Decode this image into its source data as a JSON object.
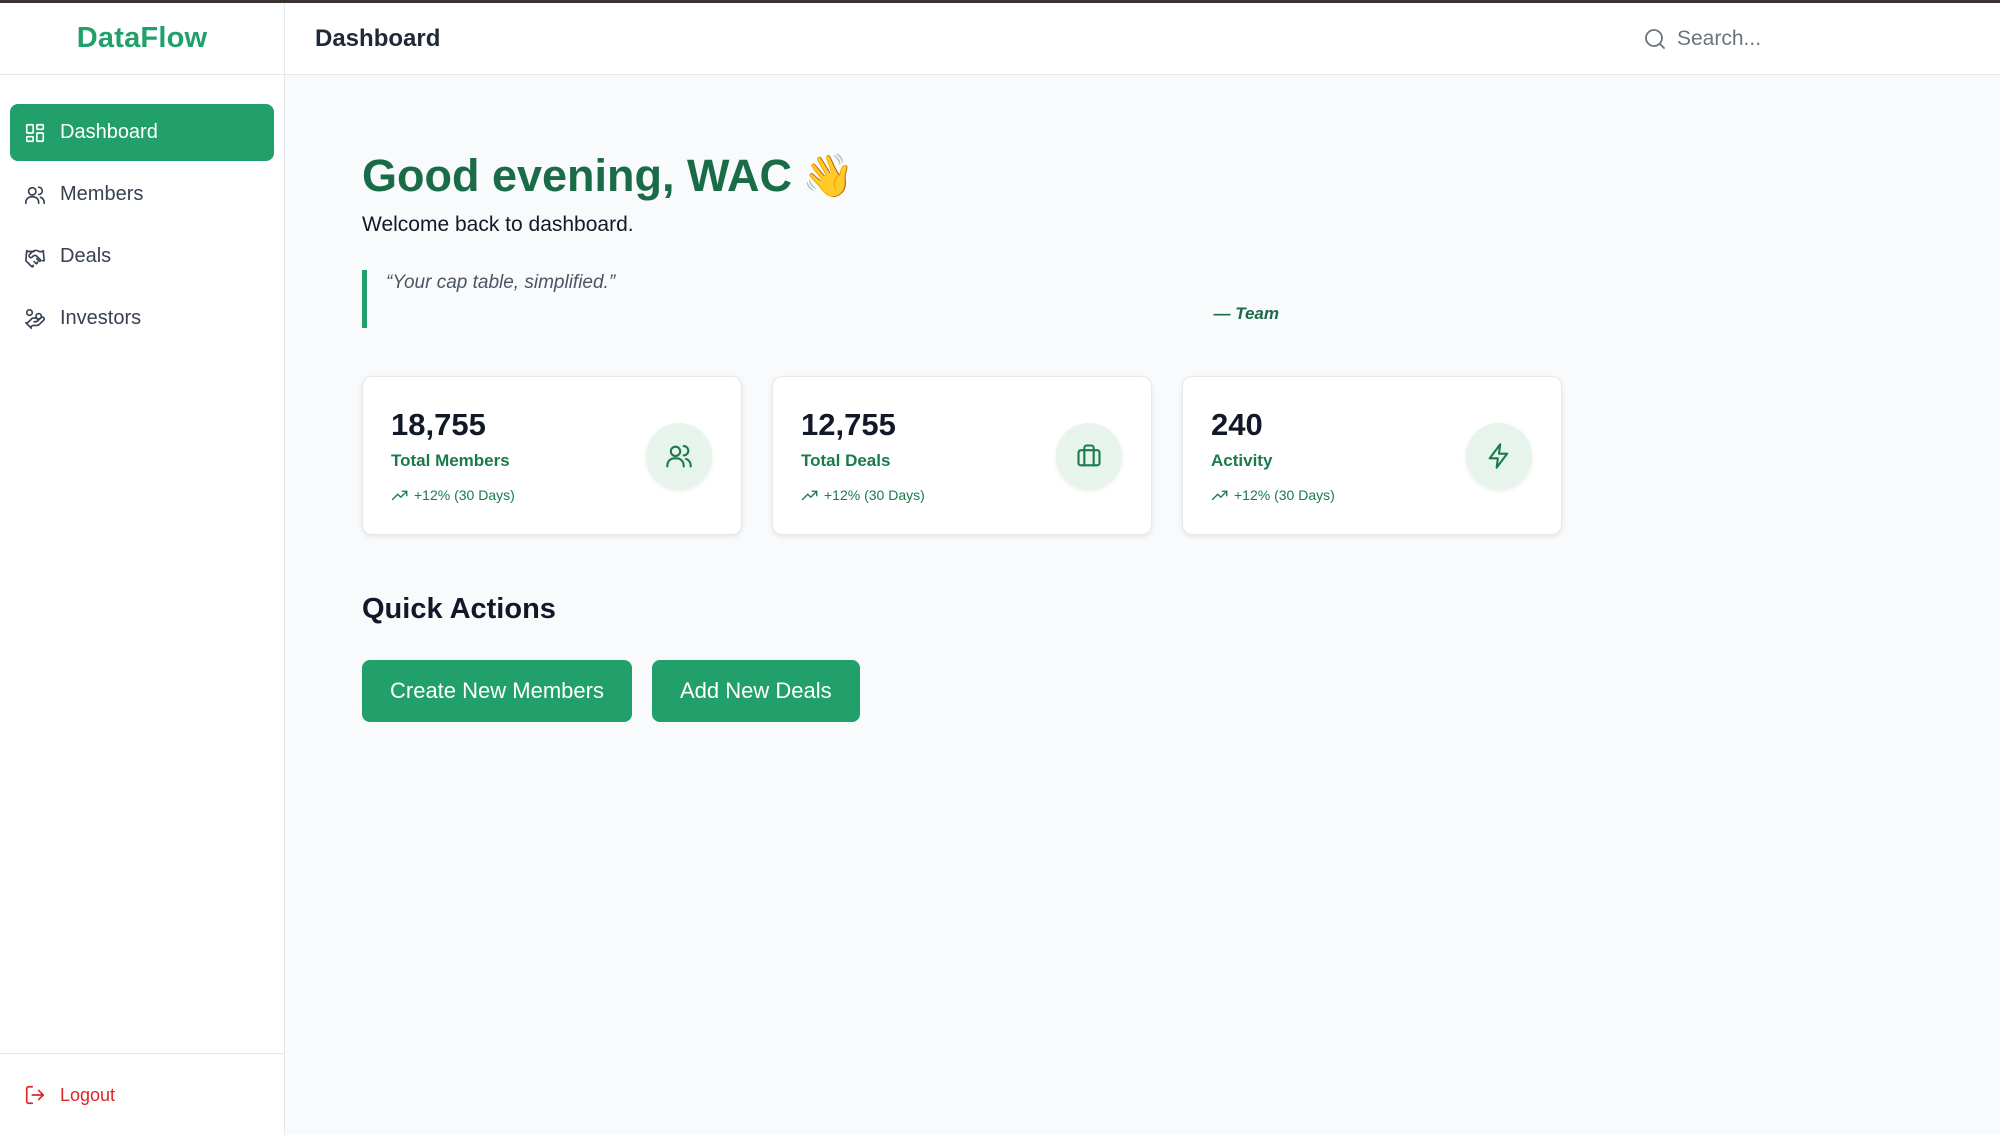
{
  "app": {
    "brand": "DataFlow"
  },
  "header": {
    "title": "Dashboard",
    "search_placeholder": "Search..."
  },
  "sidebar": {
    "items": [
      {
        "label": "Dashboard",
        "icon": "dashboard-grid-icon",
        "active": true
      },
      {
        "label": "Members",
        "icon": "users-icon",
        "active": false
      },
      {
        "label": "Deals",
        "icon": "handshake-icon",
        "active": false
      },
      {
        "label": "Investors",
        "icon": "hand-coins-icon",
        "active": false
      }
    ],
    "logout_label": "Logout"
  },
  "main": {
    "greeting": "Good evening, WAC",
    "greeting_emoji": "👋",
    "welcome": "Welcome back to dashboard.",
    "quote": {
      "text": "“Your cap table, simplified.”",
      "author": "— Team"
    },
    "stats": [
      {
        "value": "18,755",
        "label": "Total Members",
        "trend": "+12% (30 Days)",
        "icon": "users-icon"
      },
      {
        "value": "12,755",
        "label": "Total Deals",
        "trend": "+12% (30 Days)",
        "icon": "briefcase-icon"
      },
      {
        "value": "240",
        "label": "Activity",
        "trend": "+12% (30 Days)",
        "icon": "lightning-icon"
      }
    ],
    "quick_actions": {
      "title": "Quick Actions",
      "buttons": [
        "Create New Members",
        "Add New Deals"
      ]
    }
  },
  "colors": {
    "accent": "#22a06b",
    "accent_dark": "#1a6b47",
    "logout": "#dc2626"
  }
}
